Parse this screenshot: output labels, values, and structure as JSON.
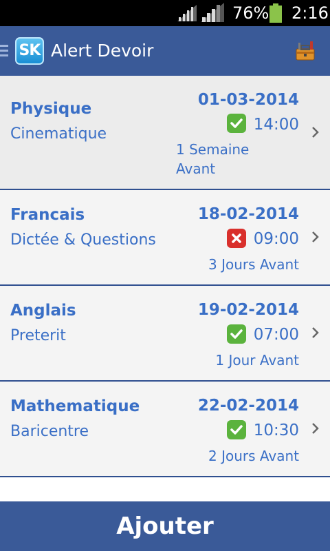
{
  "status_bar": {
    "battery_percent": "76%",
    "time": "2:16",
    "battery_color": "#8bc34a"
  },
  "action_bar": {
    "logo_text": "SK",
    "title": "Alert Devoir",
    "background": "#3a5a98",
    "right_icon": "toolbox-icon"
  },
  "items": [
    {
      "subject": "Physique",
      "topic": "Cinematique",
      "date": "01-03-2014",
      "status": "done",
      "time": "14:00",
      "relative_line1": "1 Semaine",
      "relative_line2": "Avant"
    },
    {
      "subject": "Francais",
      "topic": "Dictée & Questions",
      "date": "18-02-2014",
      "status": "cancelled",
      "time": "09:00",
      "relative": "3 Jours Avant"
    },
    {
      "subject": "Anglais",
      "topic": "Preterit",
      "date": "19-02-2014",
      "status": "done",
      "time": "07:00",
      "relative": "1 Jour Avant"
    },
    {
      "subject": "Mathematique",
      "topic": "Baricentre",
      "date": "22-02-2014",
      "status": "done",
      "time": "10:30",
      "relative": "2 Jours Avant"
    }
  ],
  "footer": {
    "add_label": "Ajouter"
  },
  "colors": {
    "accent_text": "#3a6fc6",
    "check_green": "#5bb33d",
    "cross_red": "#d9302c"
  }
}
